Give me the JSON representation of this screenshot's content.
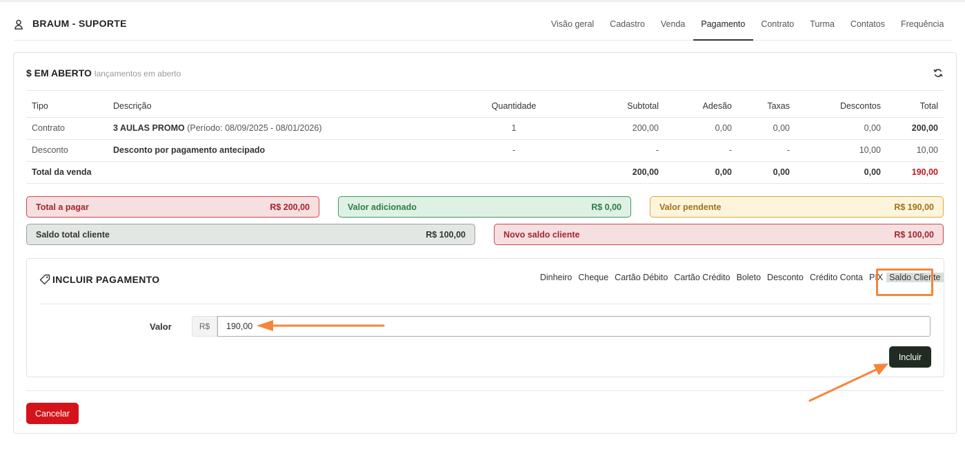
{
  "header": {
    "client_name": "BRAUM - SUPORTE",
    "tabs": [
      {
        "label": "Visão geral"
      },
      {
        "label": "Cadastro"
      },
      {
        "label": "Venda"
      },
      {
        "label": "Pagamento",
        "active": true
      },
      {
        "label": "Contrato"
      },
      {
        "label": "Turma"
      },
      {
        "label": "Contatos"
      },
      {
        "label": "Frequência"
      }
    ]
  },
  "open_section": {
    "title": "$ EM ABERTO",
    "subtitle": "lançamentos em aberto",
    "columns": [
      "Tipo",
      "Descrição",
      "Quantidade",
      "Subtotal",
      "Adesão",
      "Taxas",
      "Descontos",
      "Total"
    ],
    "rows": [
      {
        "tipo": "Contrato",
        "descricao_bold": "3 AULAS PROMO",
        "descricao_extra": "(Período: 08/09/2025 - 08/01/2026)",
        "quantidade": "1",
        "subtotal": "200,00",
        "adesao": "0,00",
        "taxas": "0,00",
        "descontos": "0,00",
        "total": "200,00"
      },
      {
        "tipo": "Desconto",
        "descricao_bold": "Desconto por pagamento antecipado",
        "descricao_extra": "",
        "quantidade": "-",
        "subtotal": "-",
        "adesao": "-",
        "taxas": "-",
        "descontos": "10,00",
        "total": "10,00"
      }
    ],
    "totals": {
      "label": "Total da venda",
      "subtotal": "200,00",
      "adesao": "0,00",
      "taxas": "0,00",
      "descontos": "0,00",
      "total": "190,00"
    }
  },
  "summary": {
    "total_pagar": {
      "label": "Total a pagar",
      "value": "R$ 200,00"
    },
    "valor_adicionado": {
      "label": "Valor adicionado",
      "value": "R$ 0,00"
    },
    "valor_pendente": {
      "label": "Valor pendente",
      "value": "R$ 190,00"
    },
    "saldo_total": {
      "label": "Saldo total cliente",
      "value": "R$ 100,00"
    },
    "novo_saldo": {
      "label": "Novo saldo cliente",
      "value": "R$ 100,00"
    }
  },
  "payment": {
    "title": "INCLUIR PAGAMENTO",
    "methods": [
      {
        "label": "Dinheiro"
      },
      {
        "label": "Cheque"
      },
      {
        "label": "Cartão Débito"
      },
      {
        "label": "Cartão Crédito"
      },
      {
        "label": "Boleto"
      },
      {
        "label": "Desconto"
      },
      {
        "label": "Crédito Conta"
      },
      {
        "label": "PIX"
      },
      {
        "label": "Saldo Cliente",
        "selected": true
      }
    ],
    "valor_label": "Valor",
    "currency_prefix": "R$",
    "valor_value": "190,00",
    "incluir_label": "Incluir"
  },
  "cancel_label": "Cancelar",
  "colors": {
    "annotation": "#f5853b",
    "danger": "#d4141a",
    "dark_button": "#212b22"
  }
}
